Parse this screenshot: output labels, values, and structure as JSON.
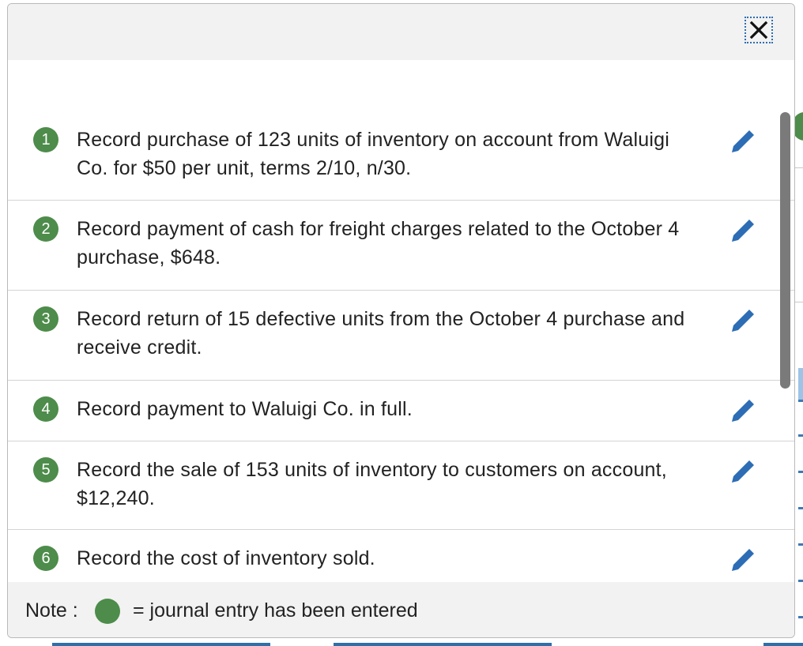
{
  "close_button": {
    "label": "×"
  },
  "entries": [
    {
      "number": "1",
      "text": "Record purchase of 123 units of inventory on account from Waluigi Co. for $50 per unit, terms 2/10, n/30."
    },
    {
      "number": "2",
      "text": "Record payment of cash for freight charges related to the October 4 purchase, $648."
    },
    {
      "number": "3",
      "text": "Record return of 15 defective units from the October 4 purchase and receive credit."
    },
    {
      "number": "4",
      "text": "Record payment to Waluigi Co. in full."
    },
    {
      "number": "5",
      "text": "Record the sale of 153 units of inventory to customers on account, $12,240."
    },
    {
      "number": "6",
      "text": "Record the cost of inventory sold."
    }
  ],
  "note": {
    "label": "Note :",
    "text": "= journal entry has been entered"
  },
  "colors": {
    "badge_green": "#4d8c4a",
    "edit_blue": "#2d6db5",
    "header_gray": "#f2f2f2"
  },
  "icons": {
    "close": "close-icon",
    "edit": "pencil-icon",
    "entered_marker": "green-dot-icon"
  }
}
